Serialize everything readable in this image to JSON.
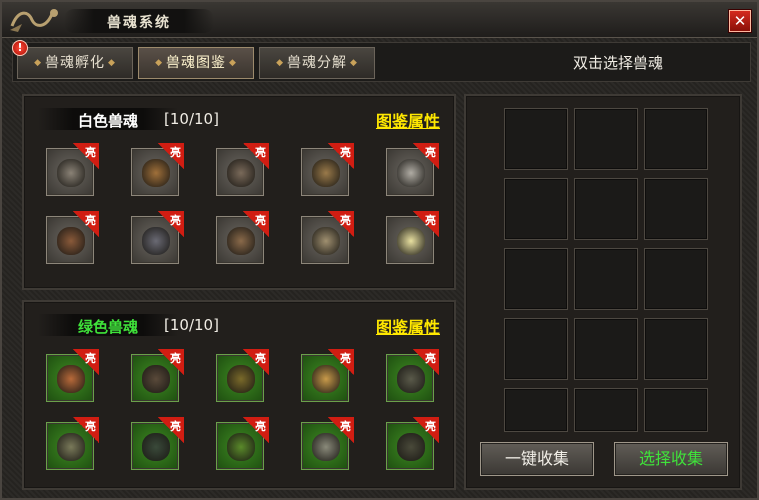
{
  "window": {
    "title": "兽魂系统",
    "close_symbol": "✕",
    "alert_symbol": "!",
    "accent_color": "#ffe800"
  },
  "tabs": [
    {
      "label": "兽魂孵化"
    },
    {
      "label": "兽魂图鉴"
    },
    {
      "label": "兽魂分解"
    }
  ],
  "hint": "双击选择兽魂",
  "sections": [
    {
      "name": "白色兽魂",
      "name_color": "#ffffff",
      "count": "[10/10]",
      "link": "图鉴属性",
      "badge": "亮",
      "slot_style": "white",
      "icons": [
        "beast-icon",
        "spider-icon",
        "scorpion-icon",
        "crab-icon",
        "skeleton-icon",
        "warrior-icon",
        "bomb-icon",
        "bird-icon",
        "monk-icon",
        "orb-icon"
      ]
    },
    {
      "name": "绿色兽魂",
      "name_color": "#3fe23a",
      "count": "[10/10]",
      "link": "图鉴属性",
      "badge": "亮",
      "slot_style": "green",
      "icons": [
        "insect-icon",
        "golem-icon",
        "mantis-icon",
        "flower-icon",
        "ogre-icon",
        "frog-icon",
        "toad-icon",
        "goblin-icon",
        "knight-icon",
        "spider-icon"
      ]
    }
  ],
  "buttons": {
    "collect_all": "一键收集",
    "select_collect": "选择收集"
  }
}
